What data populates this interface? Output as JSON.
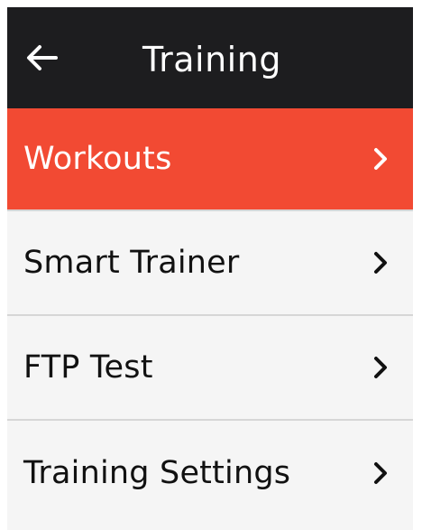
{
  "header": {
    "title": "Training",
    "back_icon": "arrow-left-icon"
  },
  "menu": {
    "items": [
      {
        "label": "Workouts",
        "icon": "chevron-right-icon",
        "selected": true
      },
      {
        "label": "Smart Trainer",
        "icon": "chevron-right-icon",
        "selected": false
      },
      {
        "label": "FTP Test",
        "icon": "chevron-right-icon",
        "selected": false
      },
      {
        "label": "Training Settings",
        "icon": "chevron-right-icon",
        "selected": false
      }
    ]
  },
  "colors": {
    "header_bg": "#1d1d1f",
    "accent": "#f24a33",
    "list_bg": "#f5f5f5",
    "divider": "#d6d6d6"
  }
}
